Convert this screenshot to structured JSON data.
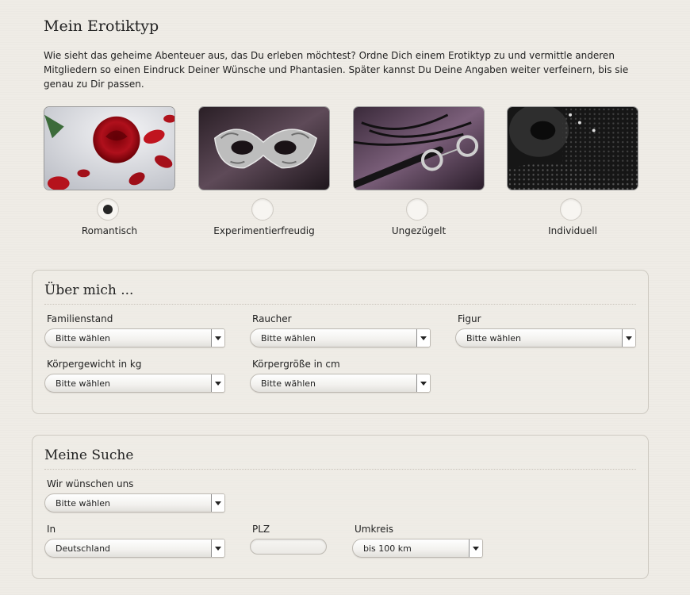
{
  "erotiktyp": {
    "title": "Mein Erotiktyp",
    "intro": "Wie sieht das geheime Abenteuer aus, das Du erleben möchtest? Ordne Dich einem Erotiktyp zu und vermittle anderen Mitgliedern so einen Eindruck Deiner Wünsche und Phantasien. Später kannst Du Deine Angaben weiter verfeinern, bis sie genau zu Dir passen.",
    "types": [
      {
        "label": "Romantisch",
        "selected": true,
        "image": "red-roses-image"
      },
      {
        "label": "Experimentierfreudig",
        "selected": false,
        "image": "silver-masquerade-mask-image"
      },
      {
        "label": "Ungezügelt",
        "selected": false,
        "image": "whip-and-handcuffs-image"
      },
      {
        "label": "Individuell",
        "selected": false,
        "image": "black-lace-mask-image"
      }
    ]
  },
  "ueber_mich": {
    "title": "Über mich ...",
    "fields": [
      {
        "label": "Familienstand",
        "value": "Bitte wählen"
      },
      {
        "label": "Raucher",
        "value": "Bitte wählen"
      },
      {
        "label": "Figur",
        "value": "Bitte wählen"
      },
      {
        "label": "Körpergewicht in kg",
        "value": "Bitte wählen"
      },
      {
        "label": "Körpergröße in cm",
        "value": "Bitte wählen"
      }
    ]
  },
  "meine_suche": {
    "title": "Meine Suche",
    "wunsch": {
      "label": "Wir wünschen uns",
      "value": "Bitte wählen"
    },
    "in": {
      "label": "In",
      "value": "Deutschland"
    },
    "plz": {
      "label": "PLZ",
      "value": ""
    },
    "umkreis": {
      "label": "Umkreis",
      "value": "bis 100 km"
    }
  },
  "colors": {
    "background": "#efece6",
    "text": "#222222",
    "panel_border": "#cdc9c1"
  }
}
